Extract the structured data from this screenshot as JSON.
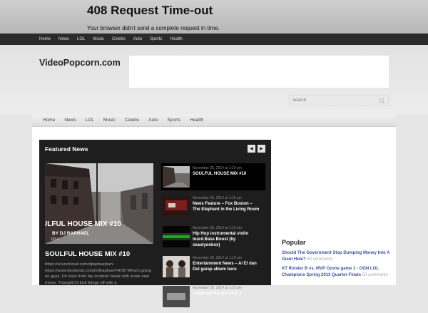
{
  "error": {
    "title": "408 Request Time-out",
    "message": "Your browser didn't send a complete request in time."
  },
  "top_nav": [
    "Home",
    "News",
    "LOL",
    "Music",
    "Celebs",
    "Auto",
    "Sports",
    "Health"
  ],
  "site": {
    "logo": "VideoPopcorn.com"
  },
  "search": {
    "placeholder": "Search"
  },
  "sub_nav": [
    "Home",
    "News",
    "LOL",
    "Music",
    "Celebs",
    "Auto",
    "Sports",
    "Health"
  ],
  "featured": {
    "heading": "Featured News",
    "main": {
      "image_caption": "ULFUL HOUSE MIX #10",
      "image_byline": "BY DJ RAPHAEL",
      "image_year": "2014",
      "title": "SOULFUL HOUSE MIX #10",
      "excerpt": "https://soundcloud.com/djraphaelparv https://www.facebook.com/DJRaphaelTHOB What's going on guys, I'm back from my summer break with some new mixes. Thought I'd kick things off with a"
    },
    "items": [
      {
        "date": "November 25, 2014 at 1:19 pm",
        "title": "SOULFUL HOUSE MIX #10"
      },
      {
        "date": "November 25, 2014 at 1:19 pm",
        "title": "News Feature – Fox Boston – The Elephant in the Living Room"
      },
      {
        "date": "November 25, 2014 at 1:19 pm",
        "title": "Hip Hop instrumental violin lourd.Bass Boost (by xsaulyonkox)"
      },
      {
        "date": "November 25, 2014 at 1:19 pm",
        "title": "Entertainment News – Ai El dan Dul garap album baru"
      },
      {
        "date": "November 25, 2014 at 1:19 pm",
        "title": "Chevrolet Prisma 2013 |"
      }
    ]
  },
  "popular": {
    "heading": "Popular",
    "items": [
      {
        "title": "Should The Government Stop Dumping Money Into A Giant Hole?",
        "comments": "50 comments"
      },
      {
        "title": "KT Rolster B vs. MVP Ozone game 1 - OGN LOL Champions Spring 2013 Quarter-Finals",
        "comments": "50 comments"
      }
    ]
  }
}
